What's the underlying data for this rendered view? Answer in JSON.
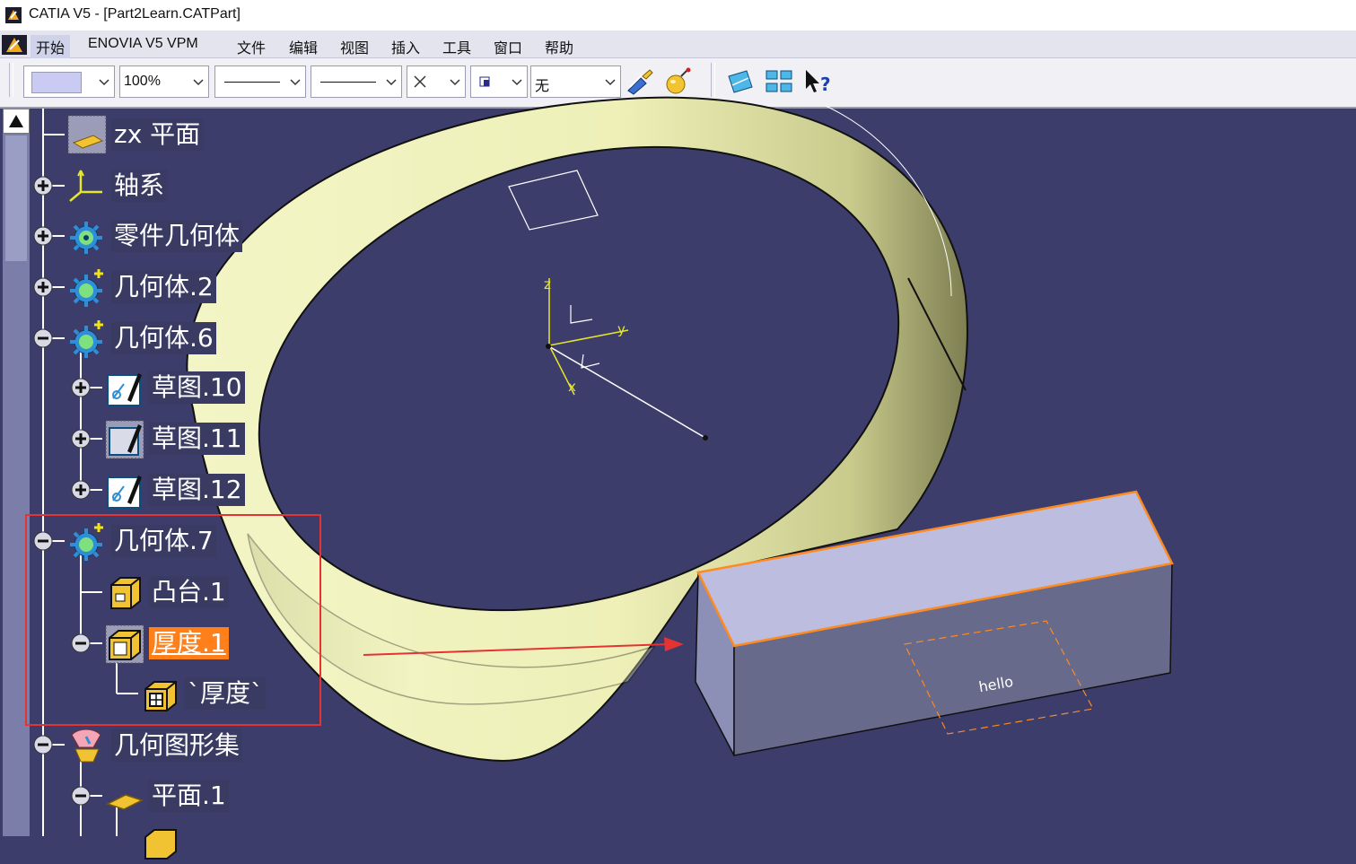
{
  "window": {
    "title": "CATIA V5 - [Part2Learn.CATPart]"
  },
  "menu": {
    "items": [
      "开始",
      "ENOVIA V5 VPM",
      "文件",
      "编辑",
      "视图",
      "插入",
      "工具",
      "窗口",
      "帮助"
    ]
  },
  "toolbar": {
    "color_combo": "",
    "transparency": "100%",
    "layer": "无"
  },
  "tree": {
    "nodes": [
      "zx 平面",
      "轴系",
      "零件几何体",
      "几何体.2",
      "几何体.6",
      "草图.10",
      "草图.11",
      "草图.12",
      "几何体.7",
      "凸台.1",
      "厚度.1",
      "`厚度`",
      "几何图形集",
      "平面.1"
    ]
  },
  "viewport": {
    "sketch_text": "hello",
    "axis_labels": {
      "z": "z",
      "y": "y",
      "x": "x"
    }
  },
  "colors": {
    "background": "#3c3d6b",
    "ring": "#eef0b8",
    "selection": "#ff7f1a",
    "highlight_box": "#e53333",
    "block_top": "#bdbde0",
    "block_front": "#686a8c"
  }
}
